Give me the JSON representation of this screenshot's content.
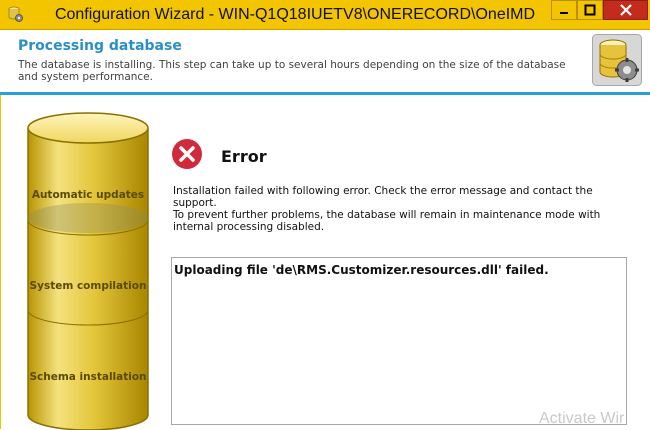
{
  "window": {
    "title": "Configuration Wizard - WIN-Q1Q18IUETV8\\ONERECORD\\OneIMD",
    "controls": [
      "minimize",
      "maximize",
      "close"
    ]
  },
  "header": {
    "title": "Processing database",
    "description": "The database is installing.  This step can take up to several hours depending on the size of the database and system performance.",
    "icon": "database-gear-icon"
  },
  "steps": {
    "items": [
      {
        "label": "Automatic updates"
      },
      {
        "label": "System compilation"
      },
      {
        "label": "Schema installation"
      }
    ]
  },
  "error": {
    "icon": "error-x-icon",
    "title": "Error",
    "message": "Installation failed with following error. Check the error message and contact the support.\nTo prevent further problems, the database will remain in maintenance mode with internal processing disabled.",
    "detail": "Uploading file 'de\\RMS.Customizer.resources.dll' failed."
  },
  "watermark": "Activate Wir",
  "colors": {
    "titlebar": "#f3c400",
    "accent_blue": "#2a8fc6",
    "header_border": "#2aa0d8",
    "close_button": "#c42b1c",
    "error_red": "#d12a3c",
    "cylinder_gold": "#e8cf4a"
  }
}
